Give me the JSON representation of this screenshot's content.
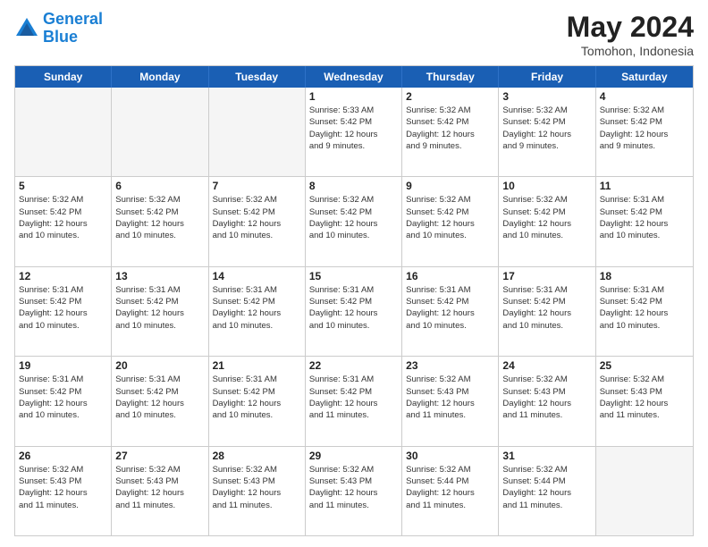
{
  "logo": {
    "line1": "General",
    "line2": "Blue"
  },
  "title": "May 2024",
  "location": "Tomohon, Indonesia",
  "dayNames": [
    "Sunday",
    "Monday",
    "Tuesday",
    "Wednesday",
    "Thursday",
    "Friday",
    "Saturday"
  ],
  "rows": [
    [
      {
        "day": "",
        "info": ""
      },
      {
        "day": "",
        "info": ""
      },
      {
        "day": "",
        "info": ""
      },
      {
        "day": "1",
        "info": "Sunrise: 5:33 AM\nSunset: 5:42 PM\nDaylight: 12 hours\nand 9 minutes."
      },
      {
        "day": "2",
        "info": "Sunrise: 5:32 AM\nSunset: 5:42 PM\nDaylight: 12 hours\nand 9 minutes."
      },
      {
        "day": "3",
        "info": "Sunrise: 5:32 AM\nSunset: 5:42 PM\nDaylight: 12 hours\nand 9 minutes."
      },
      {
        "day": "4",
        "info": "Sunrise: 5:32 AM\nSunset: 5:42 PM\nDaylight: 12 hours\nand 9 minutes."
      }
    ],
    [
      {
        "day": "5",
        "info": "Sunrise: 5:32 AM\nSunset: 5:42 PM\nDaylight: 12 hours\nand 10 minutes."
      },
      {
        "day": "6",
        "info": "Sunrise: 5:32 AM\nSunset: 5:42 PM\nDaylight: 12 hours\nand 10 minutes."
      },
      {
        "day": "7",
        "info": "Sunrise: 5:32 AM\nSunset: 5:42 PM\nDaylight: 12 hours\nand 10 minutes."
      },
      {
        "day": "8",
        "info": "Sunrise: 5:32 AM\nSunset: 5:42 PM\nDaylight: 12 hours\nand 10 minutes."
      },
      {
        "day": "9",
        "info": "Sunrise: 5:32 AM\nSunset: 5:42 PM\nDaylight: 12 hours\nand 10 minutes."
      },
      {
        "day": "10",
        "info": "Sunrise: 5:32 AM\nSunset: 5:42 PM\nDaylight: 12 hours\nand 10 minutes."
      },
      {
        "day": "11",
        "info": "Sunrise: 5:31 AM\nSunset: 5:42 PM\nDaylight: 12 hours\nand 10 minutes."
      }
    ],
    [
      {
        "day": "12",
        "info": "Sunrise: 5:31 AM\nSunset: 5:42 PM\nDaylight: 12 hours\nand 10 minutes."
      },
      {
        "day": "13",
        "info": "Sunrise: 5:31 AM\nSunset: 5:42 PM\nDaylight: 12 hours\nand 10 minutes."
      },
      {
        "day": "14",
        "info": "Sunrise: 5:31 AM\nSunset: 5:42 PM\nDaylight: 12 hours\nand 10 minutes."
      },
      {
        "day": "15",
        "info": "Sunrise: 5:31 AM\nSunset: 5:42 PM\nDaylight: 12 hours\nand 10 minutes."
      },
      {
        "day": "16",
        "info": "Sunrise: 5:31 AM\nSunset: 5:42 PM\nDaylight: 12 hours\nand 10 minutes."
      },
      {
        "day": "17",
        "info": "Sunrise: 5:31 AM\nSunset: 5:42 PM\nDaylight: 12 hours\nand 10 minutes."
      },
      {
        "day": "18",
        "info": "Sunrise: 5:31 AM\nSunset: 5:42 PM\nDaylight: 12 hours\nand 10 minutes."
      }
    ],
    [
      {
        "day": "19",
        "info": "Sunrise: 5:31 AM\nSunset: 5:42 PM\nDaylight: 12 hours\nand 10 minutes."
      },
      {
        "day": "20",
        "info": "Sunrise: 5:31 AM\nSunset: 5:42 PM\nDaylight: 12 hours\nand 10 minutes."
      },
      {
        "day": "21",
        "info": "Sunrise: 5:31 AM\nSunset: 5:42 PM\nDaylight: 12 hours\nand 10 minutes."
      },
      {
        "day": "22",
        "info": "Sunrise: 5:31 AM\nSunset: 5:42 PM\nDaylight: 12 hours\nand 11 minutes."
      },
      {
        "day": "23",
        "info": "Sunrise: 5:32 AM\nSunset: 5:43 PM\nDaylight: 12 hours\nand 11 minutes."
      },
      {
        "day": "24",
        "info": "Sunrise: 5:32 AM\nSunset: 5:43 PM\nDaylight: 12 hours\nand 11 minutes."
      },
      {
        "day": "25",
        "info": "Sunrise: 5:32 AM\nSunset: 5:43 PM\nDaylight: 12 hours\nand 11 minutes."
      }
    ],
    [
      {
        "day": "26",
        "info": "Sunrise: 5:32 AM\nSunset: 5:43 PM\nDaylight: 12 hours\nand 11 minutes."
      },
      {
        "day": "27",
        "info": "Sunrise: 5:32 AM\nSunset: 5:43 PM\nDaylight: 12 hours\nand 11 minutes."
      },
      {
        "day": "28",
        "info": "Sunrise: 5:32 AM\nSunset: 5:43 PM\nDaylight: 12 hours\nand 11 minutes."
      },
      {
        "day": "29",
        "info": "Sunrise: 5:32 AM\nSunset: 5:43 PM\nDaylight: 12 hours\nand 11 minutes."
      },
      {
        "day": "30",
        "info": "Sunrise: 5:32 AM\nSunset: 5:44 PM\nDaylight: 12 hours\nand 11 minutes."
      },
      {
        "day": "31",
        "info": "Sunrise: 5:32 AM\nSunset: 5:44 PM\nDaylight: 12 hours\nand 11 minutes."
      },
      {
        "day": "",
        "info": ""
      }
    ]
  ]
}
